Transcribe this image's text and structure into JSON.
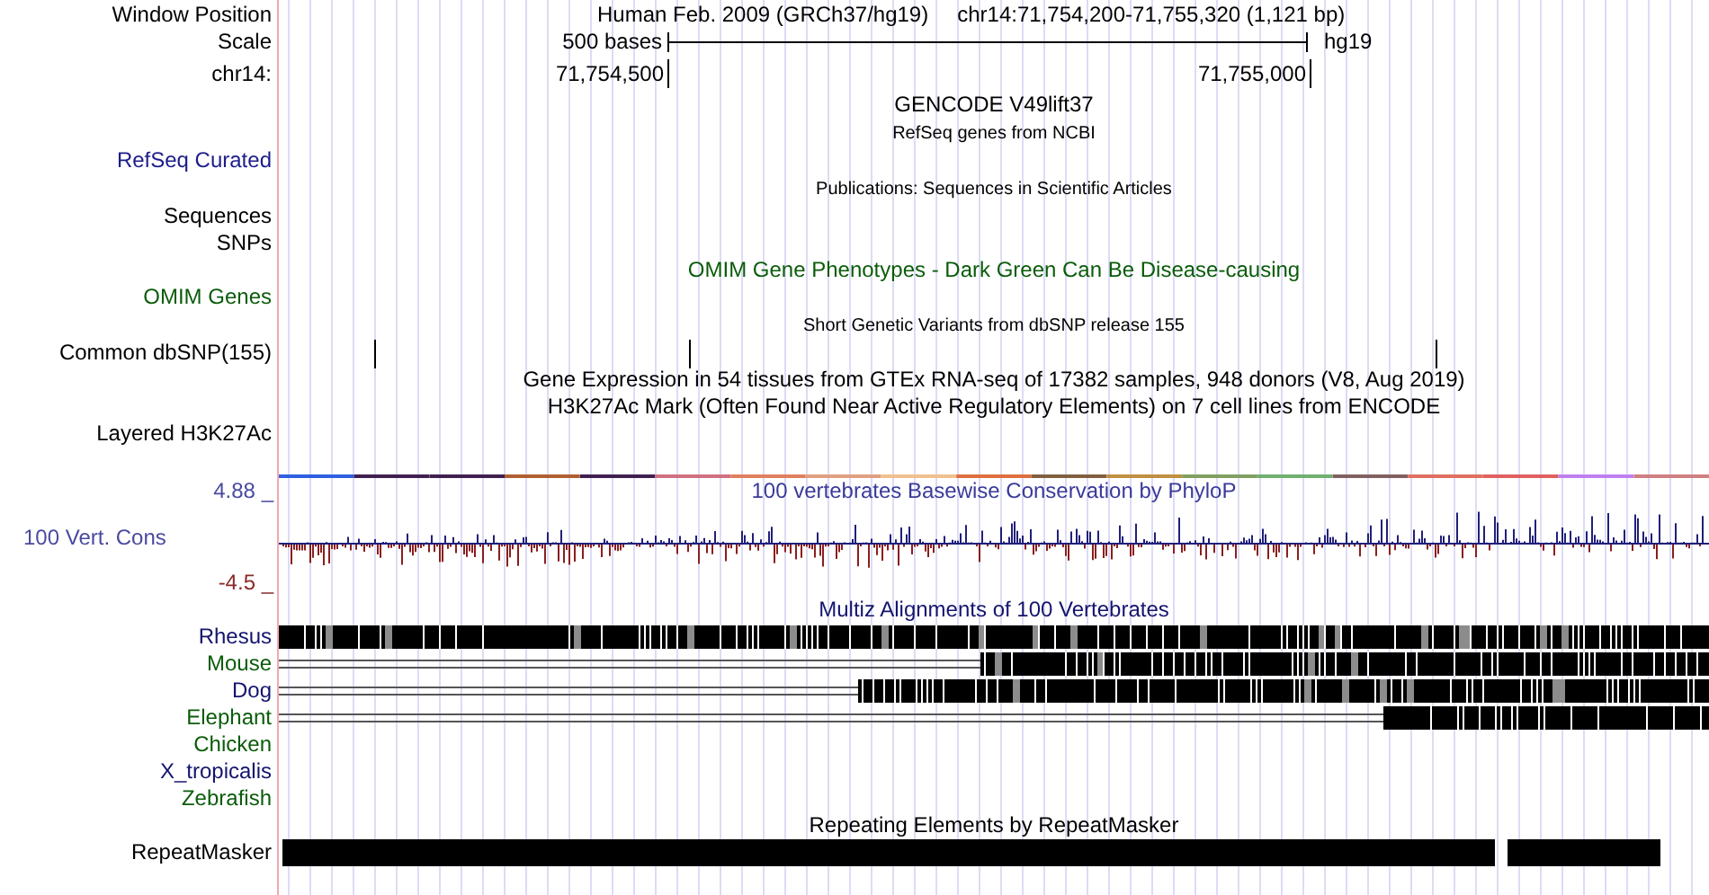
{
  "header": {
    "label": "Window Position",
    "assembly": "Human Feb. 2009 (GRCh37/hg19)",
    "position": "chr14:71,754,200-71,755,320 (1,121 bp)"
  },
  "scale": {
    "label": "Scale",
    "span": "500 bases",
    "db": "hg19"
  },
  "ruler": {
    "label": "chr14:",
    "ticks": [
      "71,754,500",
      "71,755,000"
    ]
  },
  "tracks": [
    {
      "kind": "title",
      "title": "GENCODE V49lift37"
    },
    {
      "kind": "genes",
      "title": "RefSeq genes from NCBI",
      "small_title": true,
      "rows": [
        {
          "label": "RefSeq Curated",
          "color": "#1c1c8a"
        }
      ]
    },
    {
      "kind": "genes",
      "title": "Publications: Sequences in Scientific Articles",
      "small_title": true,
      "rows": [
        {
          "label": "Sequences",
          "color": "#000000"
        },
        {
          "label": "SNPs",
          "color": "#000000"
        }
      ]
    },
    {
      "kind": "genes",
      "title": "OMIM Gene Phenotypes - Dark Green Can Be Disease-causing",
      "color": "#0a5c0a",
      "rows": [
        {
          "label": "OMIM Genes",
          "color": "#0a5c0a"
        }
      ]
    },
    {
      "kind": "snps",
      "title": "Short Genetic Variants from dbSNP release 155",
      "small_title": true,
      "rows": [
        {
          "label": "Common dbSNP(155)",
          "color": "#000000"
        }
      ]
    },
    {
      "kind": "title",
      "title": "Gene Expression in 54 tissues from GTEx RNA-seq of 17382 samples, 948 donors (V8, Aug 2019)"
    },
    {
      "kind": "layered",
      "title": "H3K27Ac Mark (Often Found Near Active Regulatory Elements) on 7 cell lines from ENCODE",
      "rows": [
        {
          "label": "Layered H3K27Ac",
          "color": "#000000"
        }
      ]
    },
    {
      "kind": "wiggle",
      "title": "100 vertebrates Basewise Conservation by PhyloP",
      "color": "#3a3a9a",
      "max": "4.88 _",
      "label": "100 Vert. Cons",
      "min": "-4.5 _"
    },
    {
      "kind": "alignment",
      "title": "Multiz Alignments of 100 Vertebrates",
      "color": "#14146e",
      "rows": [
        {
          "label": "Rhesus",
          "color": "#14146e"
        },
        {
          "label": "Mouse",
          "color": "#0a5c0a"
        },
        {
          "label": "Dog",
          "color": "#14146e"
        },
        {
          "label": "Elephant",
          "color": "#0a5c0a"
        },
        {
          "label": "Chicken",
          "color": "#0a5c0a"
        },
        {
          "label": "X_tropicalis",
          "color": "#14146e"
        },
        {
          "label": "Zebrafish",
          "color": "#0a5c0a"
        }
      ]
    },
    {
      "kind": "repeats",
      "title": "Repeating Elements by RepeatMasker",
      "rows": [
        {
          "label": "RepeatMasker",
          "color": "#000000"
        }
      ]
    }
  ]
}
